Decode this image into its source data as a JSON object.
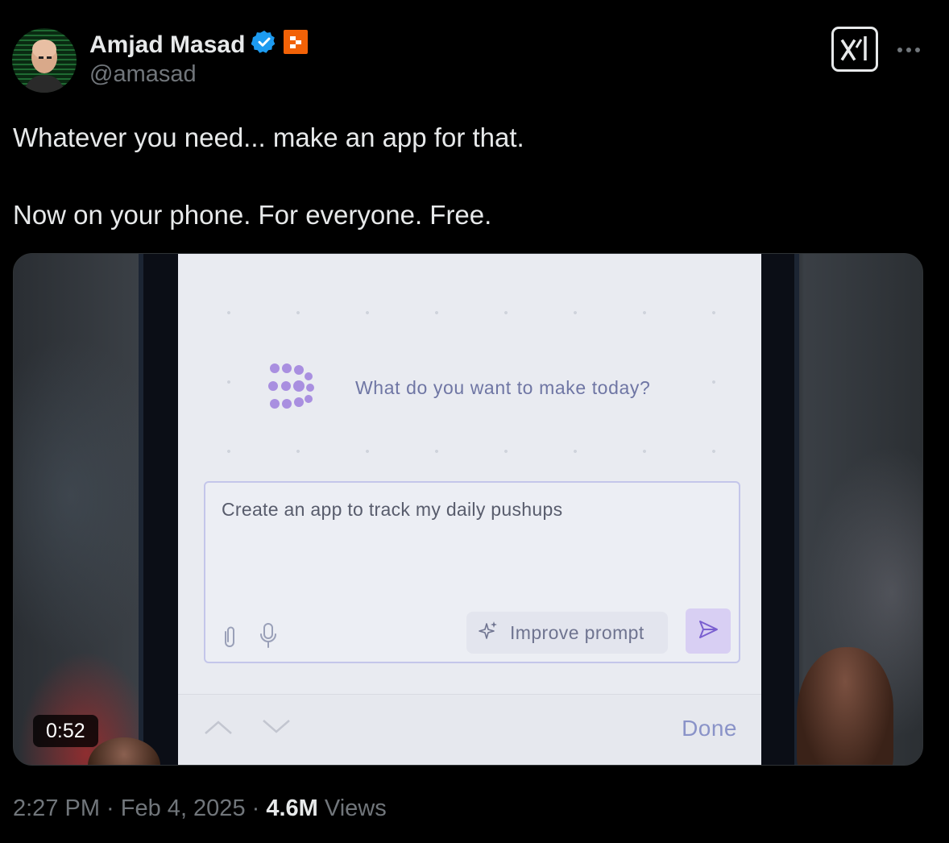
{
  "author": {
    "display_name": "Amjad Masad",
    "handle": "@amasad"
  },
  "tweet": {
    "line1": "Whatever you need... make an app for that.",
    "line2": "Now on your phone. For everyone. Free."
  },
  "video": {
    "duration": "0:52",
    "screen": {
      "question": "What do you want to make today?",
      "input_value": "Create an app to track my daily pushups",
      "improve_label": "Improve prompt",
      "done_label": "Done"
    }
  },
  "meta": {
    "time": "2:27 PM",
    "sep1": " · ",
    "date": "Feb 4, 2025",
    "sep2": " · ",
    "views_count": "4.6M",
    "views_label": " Views"
  },
  "colors": {
    "background": "#000000",
    "verified_badge": "#1d9bf0",
    "affiliate_badge": "#f26207",
    "replit_logo": "#a98fe0"
  },
  "icons": {
    "verified": "verified-badge-icon",
    "affiliate": "replit-affiliate-icon",
    "xai": "xai-logo-icon",
    "more": "more-dots-icon"
  }
}
